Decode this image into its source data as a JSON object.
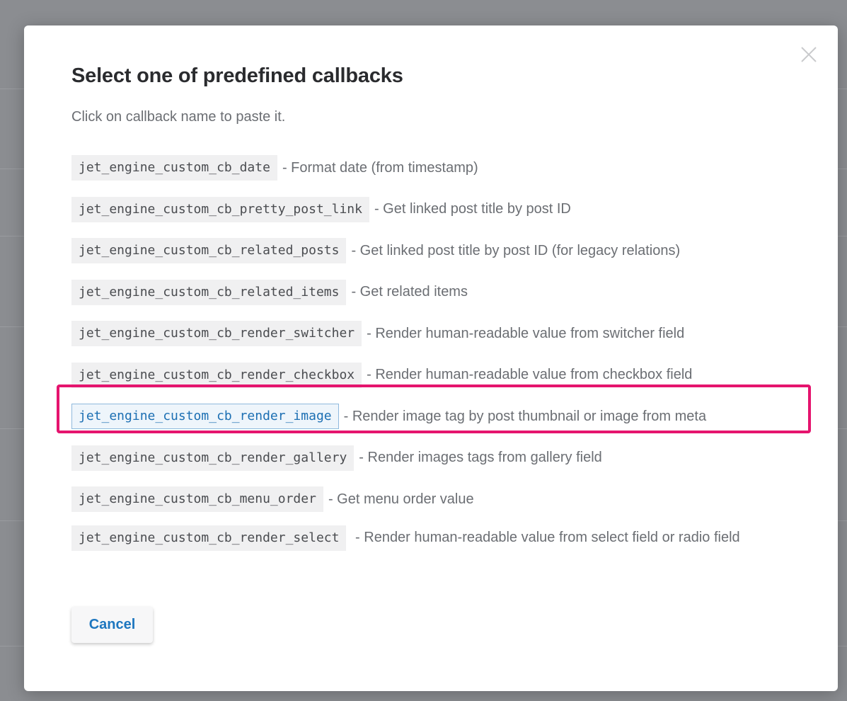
{
  "modal": {
    "title": "Select one of predefined callbacks",
    "description": "Click on callback name to paste it.",
    "close_icon": "close-icon",
    "cancel_label": "Cancel",
    "highlight_color": "#e5146e",
    "accent_color": "#1d76bf",
    "callbacks": [
      {
        "name": "jet_engine_custom_cb_date",
        "description": "- Format date (from timestamp)"
      },
      {
        "name": "jet_engine_custom_cb_pretty_post_link",
        "description": "- Get linked post title by post ID"
      },
      {
        "name": "jet_engine_custom_cb_related_posts",
        "description": "- Get linked post title by post ID (for legacy relations)"
      },
      {
        "name": "jet_engine_custom_cb_related_items",
        "description": "- Get related items"
      },
      {
        "name": "jet_engine_custom_cb_render_switcher",
        "description": "- Render human-readable value from switcher field"
      },
      {
        "name": "jet_engine_custom_cb_render_checkbox",
        "description": "- Render human-readable value from checkbox field"
      },
      {
        "name": "jet_engine_custom_cb_render_image",
        "description": "- Render image tag by post thumbnail or image from meta"
      },
      {
        "name": "jet_engine_custom_cb_render_gallery",
        "description": "- Render images tags from gallery field"
      },
      {
        "name": "jet_engine_custom_cb_menu_order",
        "description": "- Get menu order value"
      },
      {
        "name": "jet_engine_custom_cb_render_select",
        "description": "- Render human-readable value from select field or radio field"
      }
    ]
  }
}
